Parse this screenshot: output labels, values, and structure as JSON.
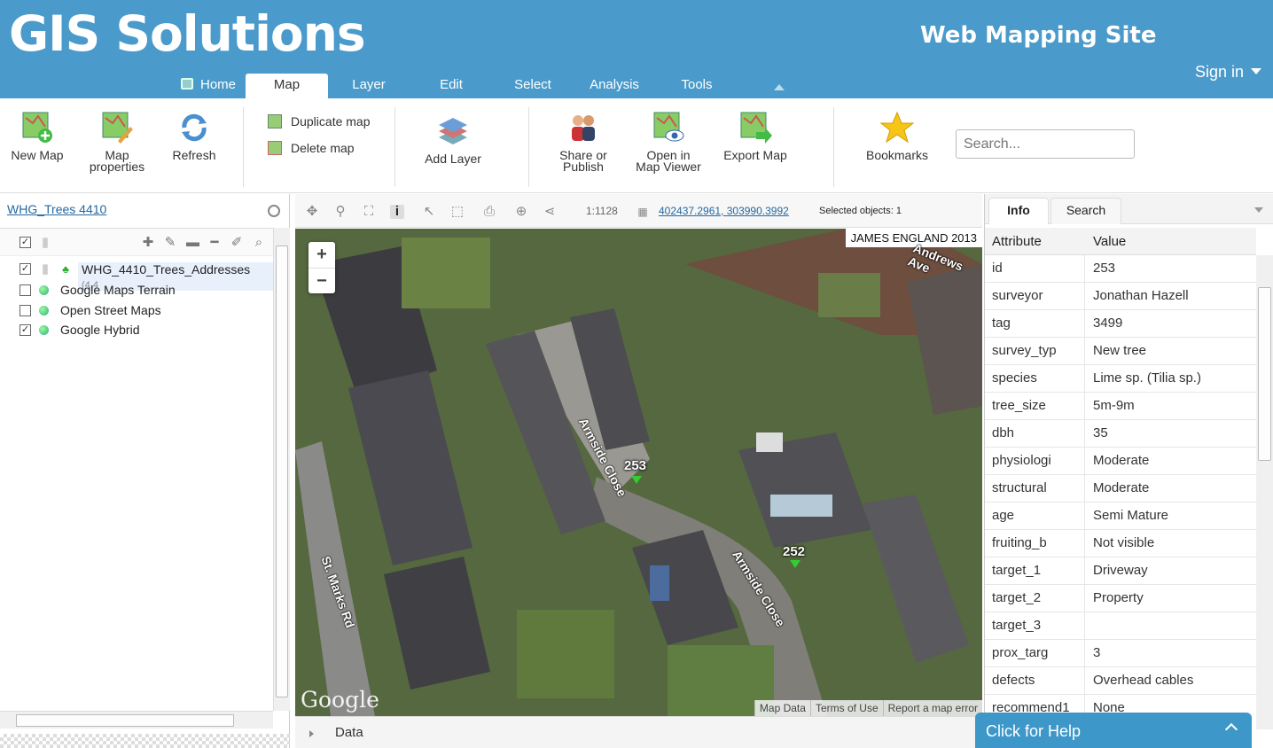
{
  "header": {
    "brand": "GIS Solutions",
    "site_title": "Web Mapping Site",
    "sign_in": "Sign in"
  },
  "tabs": [
    {
      "label": "Home"
    },
    {
      "label": "Map",
      "active": true
    },
    {
      "label": "Layer"
    },
    {
      "label": "Edit"
    },
    {
      "label": "Select"
    },
    {
      "label": "Analysis"
    },
    {
      "label": "Tools"
    }
  ],
  "ribbon": {
    "new_map": "New Map",
    "map_properties_1": "Map",
    "map_properties_2": "properties",
    "refresh": "Refresh",
    "duplicate_map": "Duplicate map",
    "delete_map": "Delete map",
    "add_layer": "Add Layer",
    "share_1": "Share or",
    "share_2": "Publish",
    "open_viewer_1": "Open in",
    "open_viewer_2": "Map Viewer",
    "export_map": "Export Map",
    "bookmarks": "Bookmarks",
    "search_placeholder": "Search..."
  },
  "layers_panel": {
    "title": "WHG_Trees 4410",
    "layers": [
      {
        "name": "WHG_4410_Trees_Addresses",
        "suffix": "(4,4",
        "checked": true
      },
      {
        "name": "Google Maps Terrain",
        "checked": false
      },
      {
        "name": "Open Street Maps",
        "checked": false
      },
      {
        "name": "Google Hybrid",
        "checked": true
      }
    ]
  },
  "map_toolbar": {
    "scale": "1:1128",
    "coordinates": "402437.2961, 303990.3992",
    "selected_objects": "Selected objects: 1"
  },
  "map": {
    "credit": "JAMES ENGLAND 2013",
    "markers": [
      "253",
      "252"
    ],
    "road_labels": [
      "Armside Close",
      "Armside Close",
      "St. Marks Rd",
      "Andrews Ave"
    ],
    "google_logo": "Google",
    "footer_links": [
      "Map Data",
      "Terms of Use",
      "Report a map error"
    ]
  },
  "data_bar": {
    "label": "Data"
  },
  "info_panel": {
    "tabs": [
      "Info",
      "Search"
    ],
    "col_attribute": "Attribute",
    "col_value": "Value",
    "rows": [
      {
        "k": "id",
        "v": "253"
      },
      {
        "k": "surveyor",
        "v": "Jonathan Hazell"
      },
      {
        "k": "tag",
        "v": "3499"
      },
      {
        "k": "survey_typ",
        "v": "New tree"
      },
      {
        "k": "species",
        "v": "Lime sp. (Tilia sp.)"
      },
      {
        "k": "tree_size",
        "v": "5m-9m"
      },
      {
        "k": "dbh",
        "v": "35"
      },
      {
        "k": "physiologi",
        "v": "Moderate"
      },
      {
        "k": "structural",
        "v": "Moderate"
      },
      {
        "k": "age",
        "v": "Semi Mature"
      },
      {
        "k": "fruiting_b",
        "v": "Not visible"
      },
      {
        "k": "target_1",
        "v": "Driveway"
      },
      {
        "k": "target_2",
        "v": "Property"
      },
      {
        "k": "target_3",
        "v": ""
      },
      {
        "k": "prox_targ",
        "v": "3"
      },
      {
        "k": "defects",
        "v": "Overhead cables"
      },
      {
        "k": "recommend1",
        "v": "None"
      }
    ]
  },
  "help": {
    "label": "Click for Help"
  }
}
